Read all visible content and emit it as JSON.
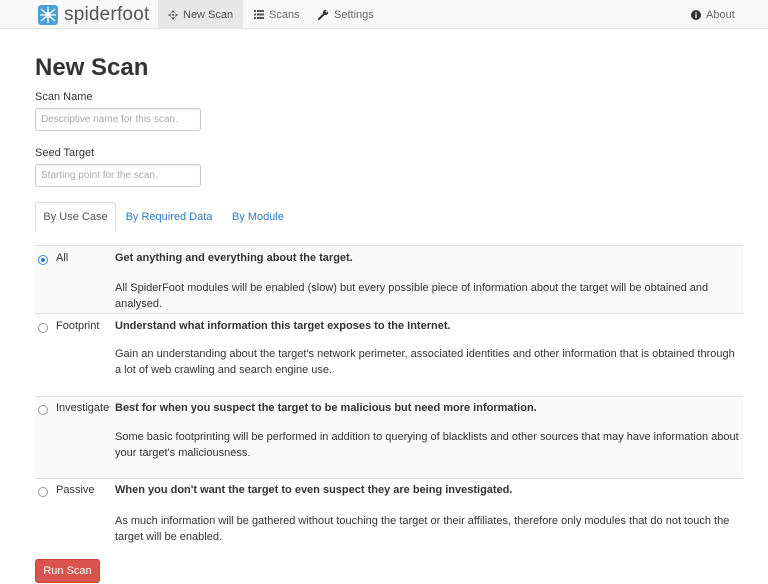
{
  "navbar": {
    "brand": "spiderfoot",
    "items": [
      {
        "label": "New Scan",
        "icon": "crosshair-icon"
      },
      {
        "label": "Scans",
        "icon": "list-icon"
      },
      {
        "label": "Settings",
        "icon": "wrench-icon"
      }
    ],
    "about": {
      "label": "About",
      "icon": "info-circle-icon"
    }
  },
  "page": {
    "title": "New Scan"
  },
  "form": {
    "scan_name": {
      "label": "Scan Name",
      "value": "",
      "placeholder": "Descriptive name for this scan."
    },
    "seed_target": {
      "label": "Seed Target",
      "value": "",
      "placeholder": "Starting point for the scan."
    }
  },
  "tabs": [
    {
      "label": "By Use Case",
      "active": true
    },
    {
      "label": "By Required Data",
      "active": false
    },
    {
      "label": "By Module",
      "active": false
    }
  ],
  "use_cases": [
    {
      "name": "All",
      "checked": true,
      "heading": "Get anything and everything about the target.",
      "description": "All SpiderFoot modules will be enabled (slow) but every possible piece of information about the target will be obtained and analysed."
    },
    {
      "name": "Footprint",
      "checked": false,
      "heading": "Understand what information this target exposes to the Internet.",
      "description": "Gain an understanding about the target's network perimeter, associated identities and other information that is obtained through a lot of web crawling and search engine use."
    },
    {
      "name": "Investigate",
      "checked": false,
      "heading": "Best for when you suspect the target to be malicious but need more information.",
      "description": "Some basic footprinting will be performed in addition to querying of blacklists and other sources that may have information about your target's maliciousness."
    },
    {
      "name": "Passive",
      "checked": false,
      "heading": "When you don't want the target to even suspect they are being investigated.",
      "description": "As much information will be gathered without touching the target or their affiliates, therefore only modules that do not touch the target will be enabled."
    }
  ],
  "actions": {
    "run_label": "Run Scan"
  },
  "colors": {
    "accent": "#d9534f",
    "link": "#2a7abf",
    "navbar_bg": "#f8f8f8"
  }
}
